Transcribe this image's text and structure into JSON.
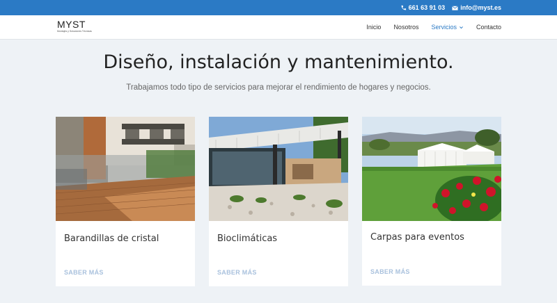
{
  "topbar": {
    "phone": "661 63 91 03",
    "email": "info@myst.es"
  },
  "brand": {
    "logo_text": "MYST",
    "tagline": "Montajes y Soluciones Técnicas"
  },
  "nav": {
    "items": [
      "Inicio",
      "Nosotros",
      "Servicios",
      "Contacto"
    ],
    "active": "Servicios"
  },
  "hero": {
    "title": "Diseño, instalación y mantenimiento.",
    "subtitle": "Trabajamos todo tipo de servicios para mejorar el rendimiento de hogares y negocios."
  },
  "cards": [
    {
      "title": "Barandillas de cristal",
      "link": "SABER MÁS"
    },
    {
      "title": "Bioclimáticas",
      "link": "SABER MÁS"
    },
    {
      "title": "Carpas para eventos",
      "link": "SABER MÁS"
    }
  ],
  "colors": {
    "accent": "#2b7ac5",
    "background": "#eef2f6",
    "link_muted": "#a9c1dd"
  }
}
